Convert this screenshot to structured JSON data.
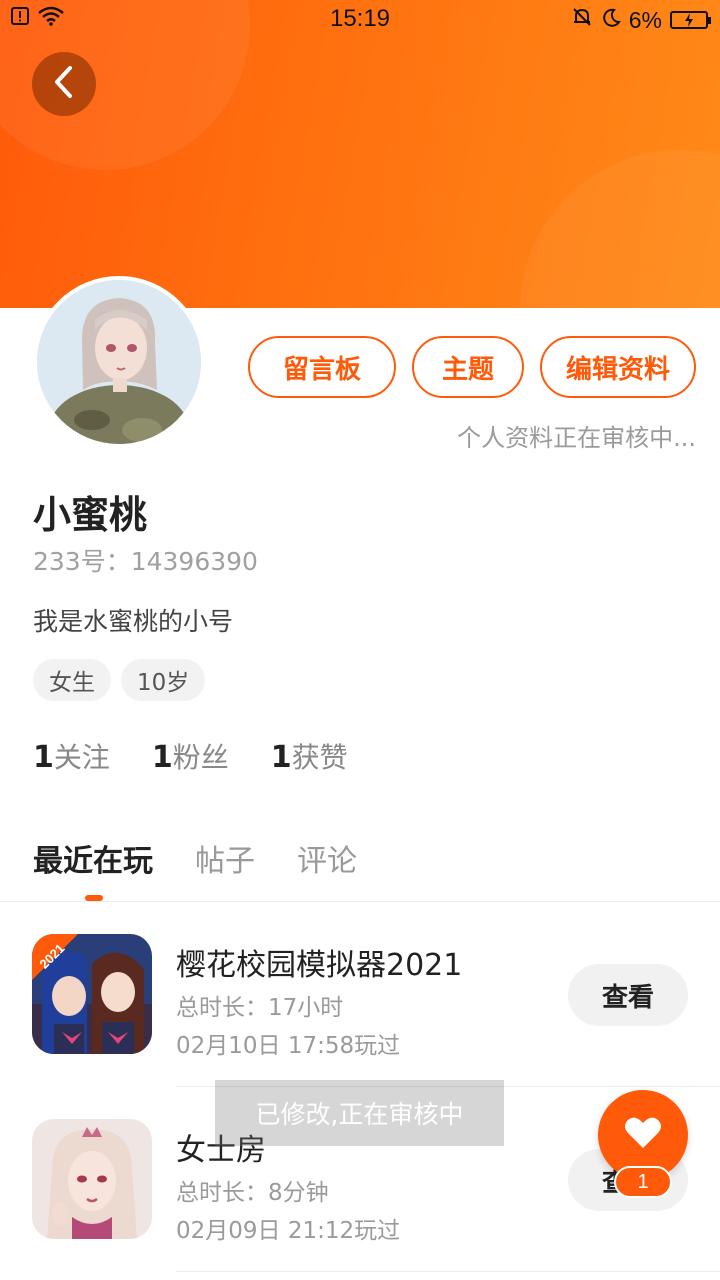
{
  "status_bar": {
    "time": "15:19",
    "battery_percent": "6%"
  },
  "profile": {
    "name": "小蜜桃",
    "id_text": "233号：14396390",
    "bio": "我是水蜜桃的小号",
    "tags": [
      "女生",
      "10岁"
    ],
    "review_note": "个人资料正在审核中..."
  },
  "actions": {
    "message_board": "留言板",
    "topics": "主题",
    "edit_profile": "编辑资料"
  },
  "stats": {
    "following_count": "1",
    "following_label": "关注",
    "fans_count": "1",
    "fans_label": "粉丝",
    "likes_count": "1",
    "likes_label": "获赞"
  },
  "tabs": [
    "最近在玩",
    "帖子",
    "评论"
  ],
  "games": [
    {
      "title": "樱花校园模拟器2021",
      "duration": "总时长：17小时",
      "last_played": "02月10日 17:58玩过",
      "button": "查看",
      "icon_badge": "2021"
    },
    {
      "title": "女士房",
      "duration": "总时长：8分钟",
      "last_played": "02月09日 21:12玩过",
      "button": "查看"
    }
  ],
  "toast": "已修改,正在审核中",
  "fab": {
    "badge": "1"
  },
  "colors": {
    "accent": "#ff5a0a",
    "header_start": "#ff5a0a",
    "header_end": "#ff8a18"
  }
}
